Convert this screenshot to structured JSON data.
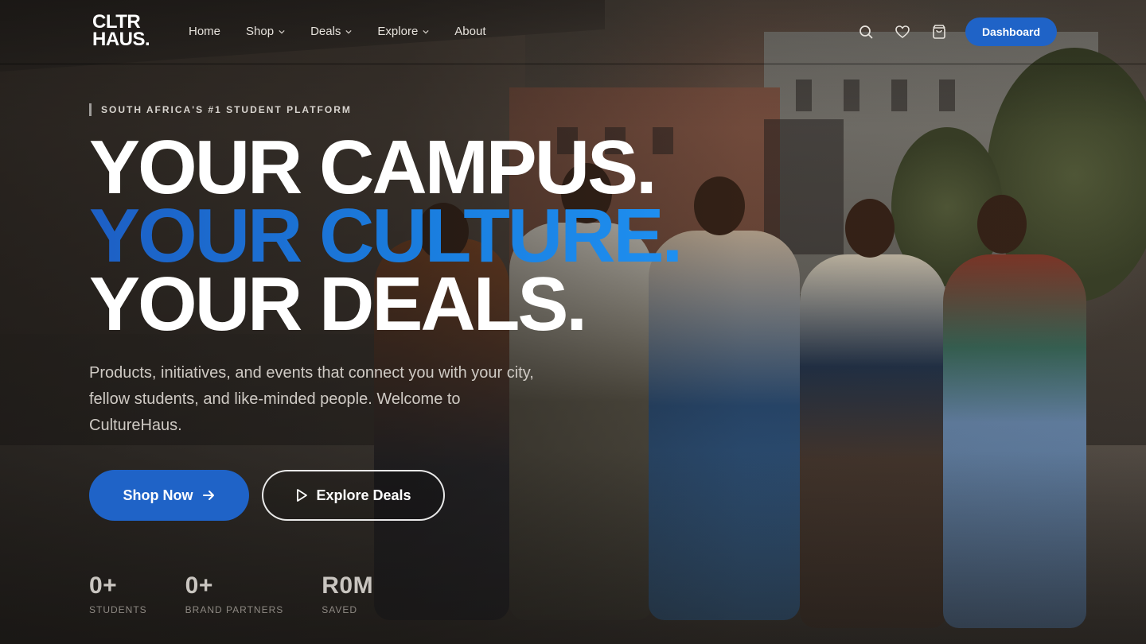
{
  "brand": {
    "logo_line1": "CLTR",
    "logo_line2": "HAUS."
  },
  "nav": {
    "items": [
      {
        "label": "Home",
        "has_dropdown": false
      },
      {
        "label": "Shop",
        "has_dropdown": true
      },
      {
        "label": "Deals",
        "has_dropdown": true
      },
      {
        "label": "Explore",
        "has_dropdown": true
      },
      {
        "label": "About",
        "has_dropdown": false
      }
    ],
    "icons": [
      "search-icon",
      "heart-icon",
      "shopping-bag-icon"
    ],
    "dashboard_label": "Dashboard"
  },
  "hero": {
    "eyebrow": "SOUTH AFRICA'S #1 STUDENT PLATFORM",
    "headline_1": "YOUR CAMPUS.",
    "headline_2": "YOUR CULTURE",
    "headline_2_dot": ".",
    "headline_3": "YOUR DEALS.",
    "subtext": "Products, initiatives, and events that connect you with your city, fellow students, and like-minded people. Welcome to CultureHaus.",
    "primary_cta": "Shop Now",
    "secondary_cta": "Explore Deals"
  },
  "stats": [
    {
      "value": "0+",
      "label": "STUDENTS"
    },
    {
      "value": "0+",
      "label": "BRAND PARTNERS"
    },
    {
      "value": "R0M",
      "label": "SAVED"
    }
  ],
  "colors": {
    "accent": "#1f63c7",
    "accent_light": "#1e8ff0"
  }
}
